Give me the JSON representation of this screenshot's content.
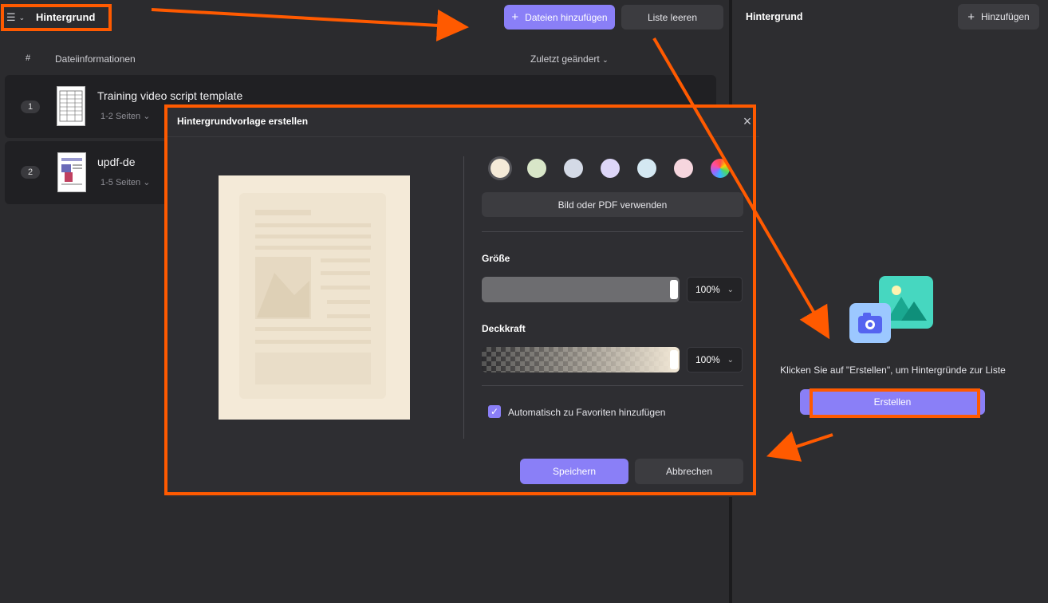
{
  "app": {
    "title": "Hintergrund",
    "menu_icon": "hamburger-icon"
  },
  "toolbar": {
    "add_files_label": "Dateien hinzufügen",
    "clear_list_label": "Liste leeren"
  },
  "table": {
    "col_index": "#",
    "col_info": "Dateiinformationen",
    "col_modified": "Zuletzt geändert",
    "rows": [
      {
        "index": "1",
        "name": "Training video script template",
        "pages": "1-2 Seiten"
      },
      {
        "index": "2",
        "name": "updf-de",
        "pages": "1-5 Seiten"
      }
    ]
  },
  "right_panel": {
    "title": "Hintergrund",
    "add_label": "Hinzufügen",
    "empty_message": "Klicken Sie auf \"Erstellen\", um Hintergründe zur Liste",
    "create_label": "Erstellen"
  },
  "modal": {
    "title": "Hintergrundvorlage erstellen",
    "swatches": [
      "#f4ead8",
      "#d8e6c8",
      "#d4dae6",
      "#ddd6f8",
      "#d4e8f2",
      "#f6d6de",
      "rainbow"
    ],
    "selected_swatch": 0,
    "use_image_label": "Bild oder PDF verwenden",
    "size_label": "Größe",
    "size_value": "100%",
    "size_fraction": 1.0,
    "opacity_label": "Deckkraft",
    "opacity_value": "100%",
    "opacity_fraction": 1.0,
    "auto_fav_label": "Automatisch zu Favoriten hinzufügen",
    "auto_fav_checked": true,
    "save_label": "Speichern",
    "cancel_label": "Abbrechen"
  },
  "colors": {
    "accent": "#8a7ff7",
    "annotation": "#ff5a00",
    "preview_bg": "#f4ead8"
  }
}
